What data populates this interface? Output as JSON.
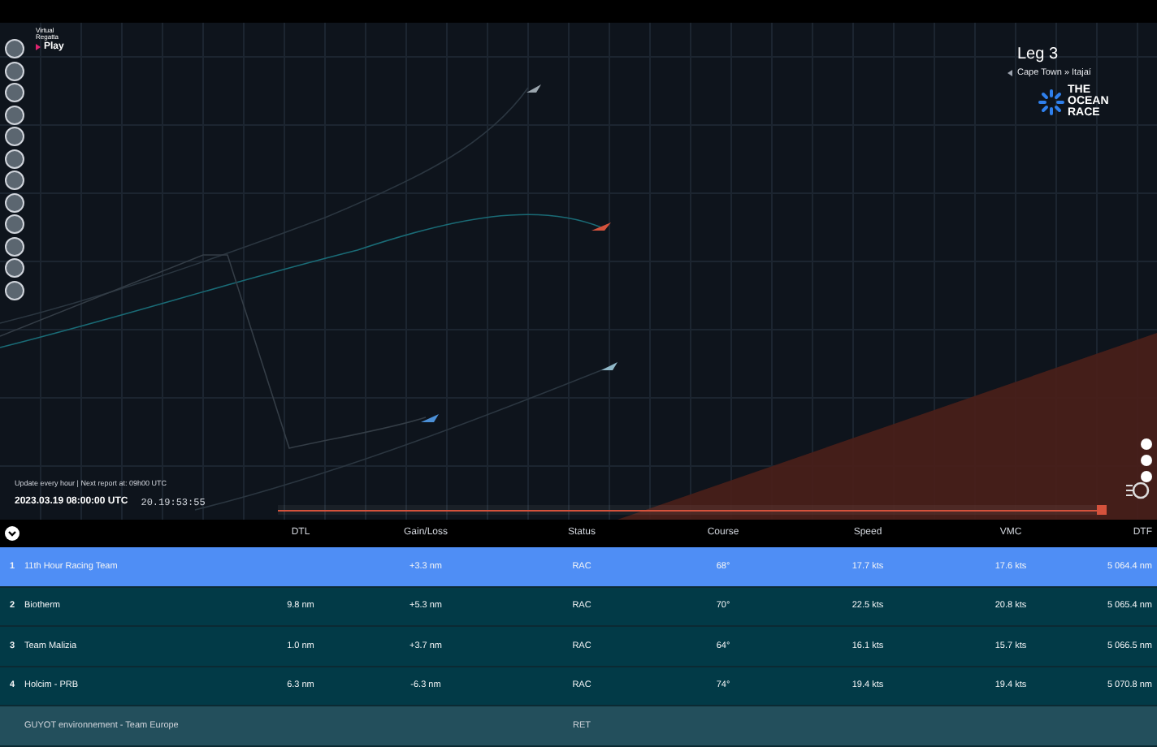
{
  "brand": {
    "name_top": "Virtual",
    "name_bottom": "Regatta",
    "play": "Play"
  },
  "leg": {
    "title": "Leg 3",
    "route": "Cape Town » Itajaí"
  },
  "race_logo": [
    "THE",
    "OCEAN",
    "RACE"
  ],
  "status_bar": {
    "update_note": "Update every hour | Next report at: 09h00 UTC",
    "date": "2023.03.19 08:00:00 UTC",
    "countdown": "20.19:53:55",
    "timeline": {
      "level": 1
    }
  },
  "table": {
    "columns": [
      "DTL",
      "Gain/Loss",
      "Status",
      "Course",
      "Speed",
      "VMC",
      "DTF"
    ],
    "rows": [
      {
        "rank": "1",
        "name": "11th Hour Racing Team",
        "selected": true,
        "retired": false,
        "dtl": "",
        "gain_loss": "+3.3 nm",
        "status": "RAC",
        "course": "68°",
        "speed": "17.7 kts",
        "vmc": "17.6 kts",
        "dtf": "5 064.4 nm"
      },
      {
        "rank": "2",
        "name": "Biotherm",
        "selected": false,
        "retired": false,
        "dtl": "9.8 nm",
        "gain_loss": "+5.3 nm",
        "status": "RAC",
        "course": "70°",
        "speed": "22.5 kts",
        "vmc": "20.8 kts",
        "dtf": "5 065.4 nm"
      },
      {
        "rank": "3",
        "name": "Team Malizia",
        "selected": false,
        "retired": false,
        "dtl": "1.0 nm",
        "gain_loss": "+3.7 nm",
        "status": "RAC",
        "course": "64°",
        "speed": "16.1 kts",
        "vmc": "15.7 kts",
        "dtf": "5 066.5 nm"
      },
      {
        "rank": "4",
        "name": "Holcim - PRB",
        "selected": false,
        "retired": false,
        "dtl": "6.3 nm",
        "gain_loss": "-6.3 nm",
        "status": "RAC",
        "course": "74°",
        "speed": "19.4 kts",
        "vmc": "19.4 kts",
        "dtf": "5 070.8 nm"
      },
      {
        "rank": "",
        "name": "GUYOT environnement - Team Europe",
        "selected": false,
        "retired": true,
        "dtl": "",
        "gain_loss": "",
        "status": "RET",
        "course": "",
        "speed": "",
        "vmc": "",
        "dtf": ""
      }
    ]
  }
}
